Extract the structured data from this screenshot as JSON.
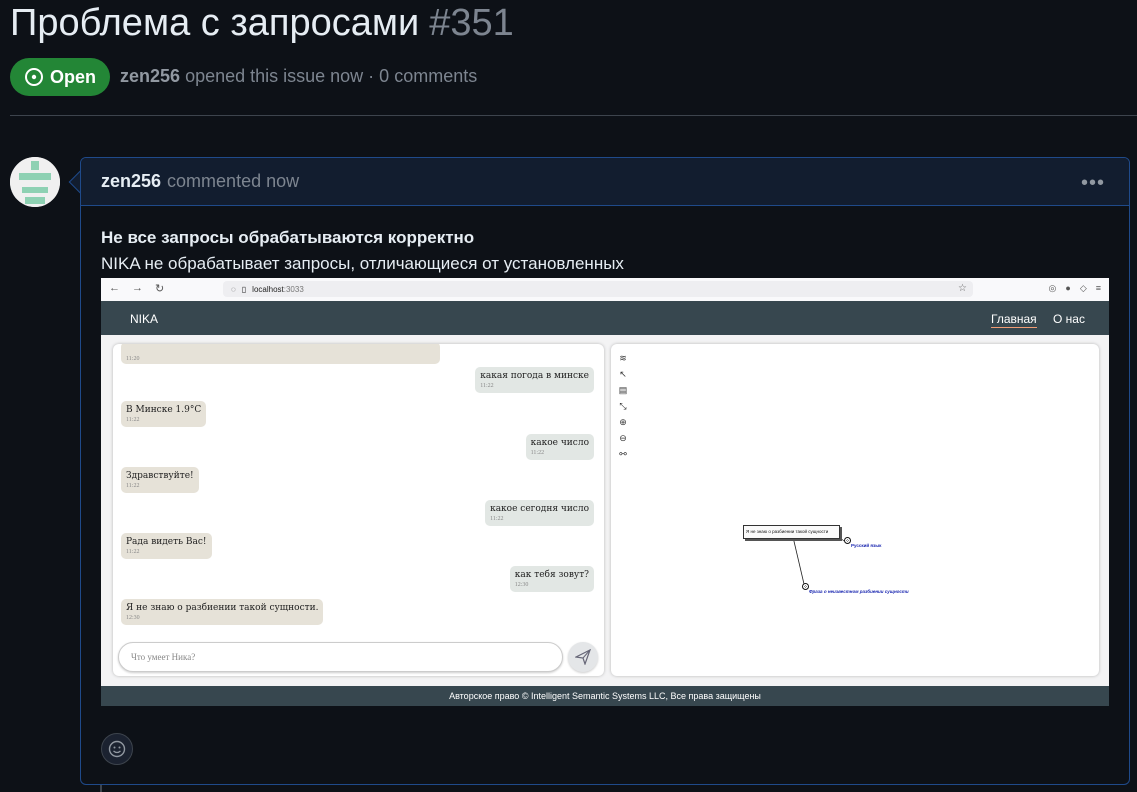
{
  "issue": {
    "title": "Проблема с запросами",
    "number": "#351",
    "status": "Open",
    "author": "zen256",
    "opened_text": "opened this issue now · 0 comments",
    "colors": {
      "open": "#238636",
      "background": "#0d1117",
      "comment_border": "#1f4a8a"
    }
  },
  "comment": {
    "author": "zen256",
    "action": "commented now",
    "menu_label": "•••",
    "heading": "Не все запросы обрабатываются корректно",
    "text": "NIKA не обрабатывает запросы, отличающиеся от установленных"
  },
  "screenshot": {
    "browser": {
      "url_host": "localhost",
      "url_port": ":3033",
      "icons": [
        "back-icon",
        "forward-icon",
        "reload-icon",
        "shield-icon",
        "page-icon",
        "bookmark-star-icon",
        "pocket-icon",
        "account-icon",
        "extensions-icon",
        "menu-icon"
      ]
    },
    "nav": {
      "brand": "NIKA",
      "home": "Главная",
      "about": "О нас"
    },
    "messages": [
      {
        "role": "bot",
        "text": "",
        "time": "11:20"
      },
      {
        "role": "user",
        "text": "какая погода в минске",
        "time": "11:22"
      },
      {
        "role": "bot",
        "text": "В Минске 1.9°C",
        "time": "11:22"
      },
      {
        "role": "user",
        "text": "какое число",
        "time": "11:22"
      },
      {
        "role": "bot",
        "text": "Здравствуйте!",
        "time": "11:22"
      },
      {
        "role": "user",
        "text": "какое сегодня число",
        "time": "11:22"
      },
      {
        "role": "bot",
        "text": "Рада видеть Вас!",
        "time": "11:22"
      },
      {
        "role": "user",
        "text": "как тебя зовут?",
        "time": "12:30"
      },
      {
        "role": "bot",
        "text": "Я не знаю о разбиении такой сущности.",
        "time": "12:30"
      }
    ],
    "input_placeholder": "Что умеет Ника?",
    "graph": {
      "node_main": "Я не знаю о разбиении такой сущности",
      "node_lang": "Русский язык",
      "node_phrase": "Фраза о неизвестном разбиении сущности"
    },
    "footer": "Авторское право © Intelligent Semantic Systems LLC, Все права защищены"
  }
}
